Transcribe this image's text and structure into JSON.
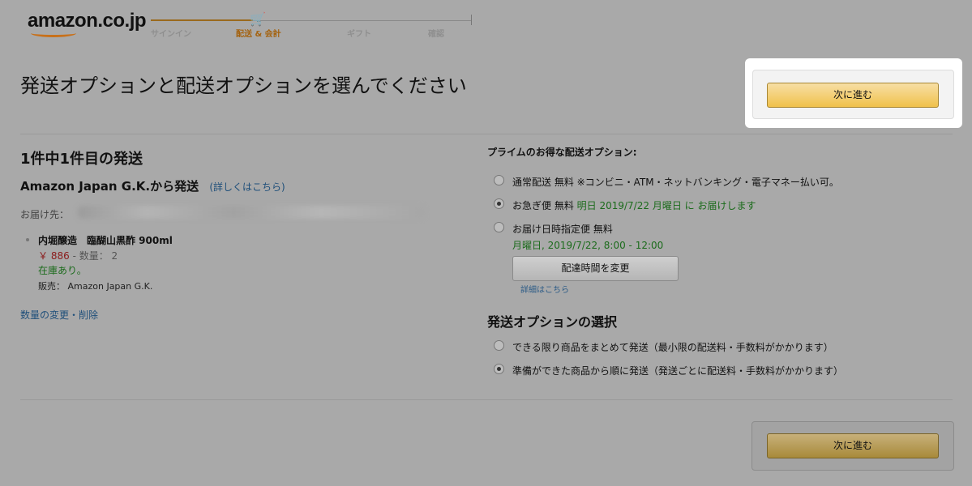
{
  "header": {
    "logo": "amazon.co.jp",
    "steps": [
      "サインイン",
      "配送 & 会計",
      "ギフト",
      "確認"
    ],
    "active_step": "配送 & 会計"
  },
  "page_title": "発送オプションと配送オプションを選んでください",
  "next_button_label": "次に進む",
  "shipment": {
    "count_label": "1件中1件目の発送",
    "seller": "Amazon Japan G.K.から発送",
    "seller_link": "(詳しくはこちら)",
    "deliver_to_label": "お届け先：",
    "product": {
      "name": "内堀醸造　臨醐山黒酢 900ml",
      "price": "￥ 886",
      "qty_label": "- 数量： 2",
      "stock": "在庫あり。",
      "sold_by": "販売： Amazon Japan G.K."
    },
    "change_link": "数量の変更・削除"
  },
  "delivery_options": {
    "heading": "プライムのお得な配送オプション:",
    "options": [
      {
        "label": "通常配送 無料 ※コンビニ・ATM・ネットバンキング・電子マネー払い可。",
        "detail": "",
        "selected": false
      },
      {
        "label": "お急ぎ便 無料",
        "detail": "明日 2019/7/22 月曜日 に お届けします",
        "selected": true
      },
      {
        "label": "お届け日時指定便 無料",
        "detail": "月曜日, 2019/7/22, 8:00 - 12:00",
        "selected": false
      }
    ],
    "change_time_button": "配達時間を変更",
    "details_link": "詳細はこちら"
  },
  "shipping_options": {
    "heading": "発送オプションの選択",
    "options": [
      {
        "label": "できる限り商品をまとめて発送（最小限の配送料・手数料がかかります）",
        "selected": false
      },
      {
        "label": "準備ができた商品から順に発送（発送ごとに配送料・手数料がかかります）",
        "selected": true
      }
    ]
  }
}
